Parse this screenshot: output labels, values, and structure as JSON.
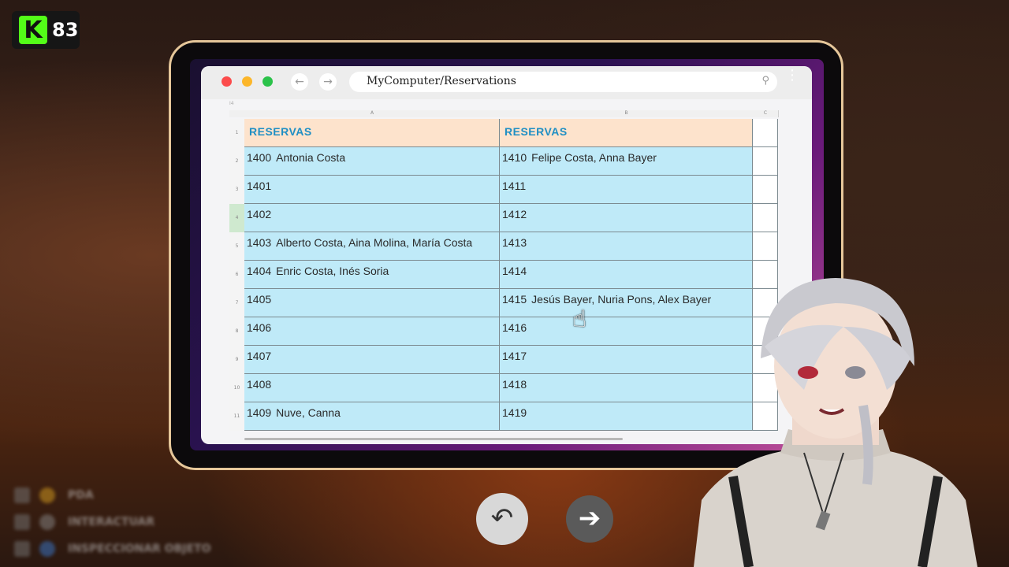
{
  "stream_badge": {
    "count": "83",
    "logo": "K"
  },
  "browser": {
    "address": "MyComputer/Reservations",
    "back_icon": "arrow-left-icon",
    "forward_icon": "arrow-right-icon",
    "search_icon": "magnifier-icon"
  },
  "sheet": {
    "cell_ref": "I4",
    "column_headers": [
      "A",
      "B",
      "C"
    ],
    "row_numbers": [
      "1",
      "2",
      "3",
      "4",
      "5",
      "6",
      "7",
      "8",
      "9",
      "10",
      "11"
    ],
    "selected_row": "4",
    "header_row": [
      "RESERVAS",
      "RESERVAS"
    ],
    "rows": [
      {
        "a_num": "1400",
        "a_names": "Antonia Costa",
        "b_num": "1410",
        "b_names": "Felipe Costa, Anna Bayer"
      },
      {
        "a_num": "1401",
        "a_names": "",
        "b_num": "1411",
        "b_names": ""
      },
      {
        "a_num": "1402",
        "a_names": "",
        "b_num": "1412",
        "b_names": ""
      },
      {
        "a_num": "1403",
        "a_names": "Alberto Costa, Aina Molina, María Costa",
        "b_num": "1413",
        "b_names": ""
      },
      {
        "a_num": "1404",
        "a_names": "Enric Costa, Inés Soria",
        "b_num": "1414",
        "b_names": ""
      },
      {
        "a_num": "1405",
        "a_names": "",
        "b_num": "1415",
        "b_names": "Jesús Bayer, Nuria Pons, Alex Bayer"
      },
      {
        "a_num": "1406",
        "a_names": "",
        "b_num": "1416",
        "b_names": ""
      },
      {
        "a_num": "1407",
        "a_names": "",
        "b_num": "1417",
        "b_names": ""
      },
      {
        "a_num": "1408",
        "a_names": "",
        "b_num": "1418",
        "b_names": ""
      },
      {
        "a_num": "1409",
        "a_names": "Nuve, Canna",
        "b_num": "1419",
        "b_names": ""
      }
    ]
  },
  "nav": {
    "undo_icon": "undo-arrow-icon",
    "next_icon": "right-arrow-icon"
  },
  "hints": [
    "PDA",
    "INTERACTUAR",
    "INSPECCIONAR OBJETO"
  ],
  "colors": {
    "header_fill": "#fde3cc",
    "header_text": "#1f8fc4",
    "data_fill": "#bfeaf8",
    "badge_green": "#53fc18"
  }
}
